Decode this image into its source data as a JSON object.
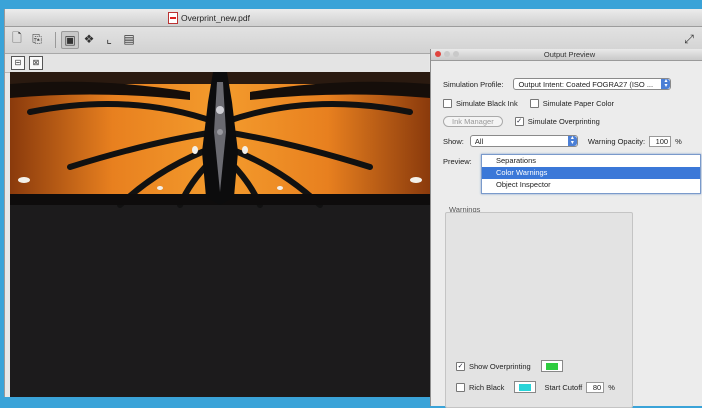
{
  "window": {
    "title": "Overprint_new.pdf"
  },
  "toolbar": {
    "buttons": [
      "new-document-icon",
      "export-icon",
      "separations-icon",
      "transparency-icon",
      "crop-marks-icon",
      "stamp-icon",
      "expand-icon"
    ]
  },
  "panel": {
    "title": "Output Preview",
    "simulation_profile_label": "Simulation Profile:",
    "simulation_profile_value": "Output Intent: Coated FOGRA27 (ISO ...",
    "simulate_black_ink_label": "Simulate Black Ink",
    "simulate_black_ink_checked": false,
    "simulate_paper_color_label": "Simulate Paper Color",
    "simulate_paper_color_checked": false,
    "ink_manager_label": "Ink Manager",
    "simulate_overprinting_label": "Simulate Overprinting",
    "simulate_overprinting_checked": true,
    "show_label": "Show:",
    "show_value": "All",
    "warning_opacity_label": "Warning Opacity:",
    "warning_opacity_value": "100",
    "warning_opacity_unit": "%",
    "preview_label": "Preview:",
    "preview_options": [
      "Separations",
      "Color Warnings",
      "Object Inspector"
    ],
    "preview_selected": "Color Warnings",
    "warnings_label": "Warnings",
    "show_overprinting_label": "Show Overprinting",
    "show_overprinting_checked": true,
    "show_overprinting_color": "#2ecc40",
    "rich_black_label": "Rich Black",
    "rich_black_checked": false,
    "rich_black_color": "#28d4d8",
    "start_cutoff_label": "Start Cutoff",
    "start_cutoff_value": "80",
    "start_cutoff_unit": "%"
  },
  "colors": {
    "accent": "#3b78d8",
    "desktop": "#3aa3d8",
    "wing_orange": "#e8801f"
  }
}
